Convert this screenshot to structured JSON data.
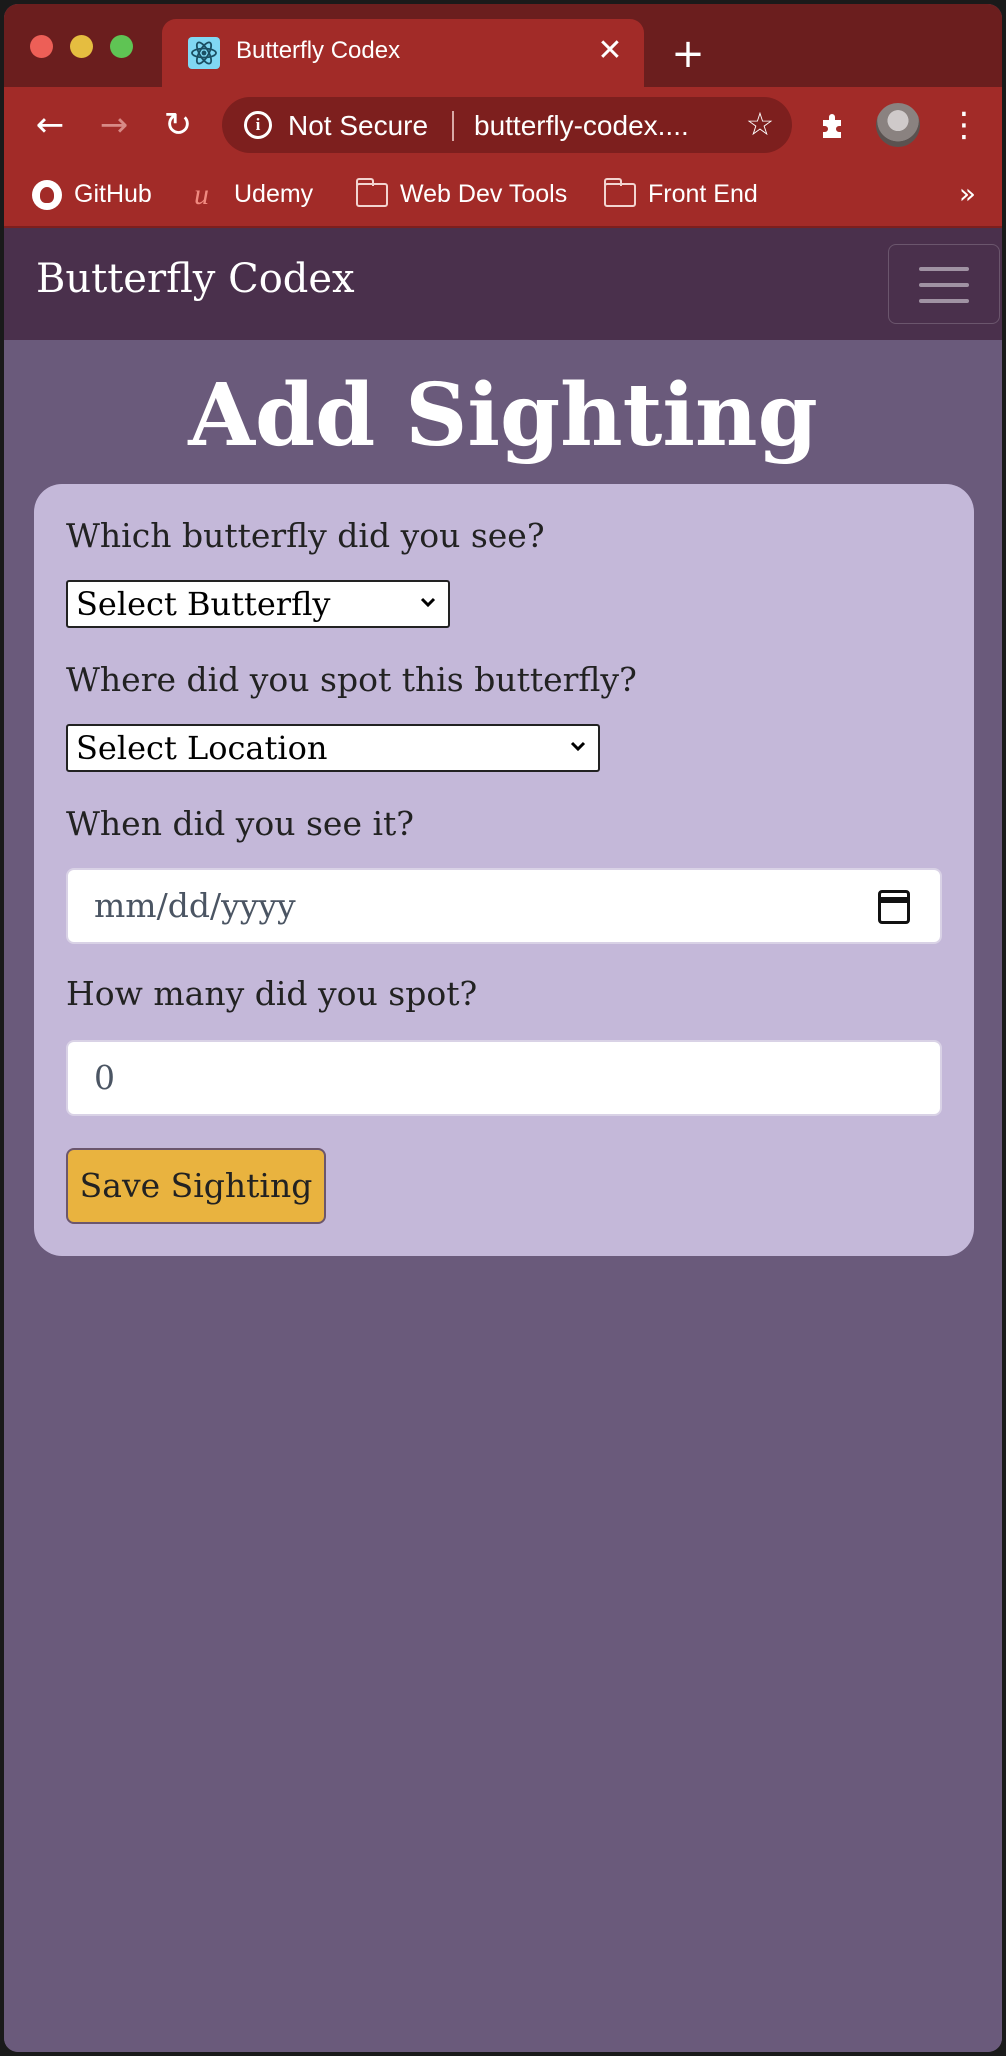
{
  "browser": {
    "tab": {
      "title": "Butterfly Codex",
      "close_glyph": "✕",
      "favicon": "react-logo-icon"
    },
    "new_tab_glyph": "+",
    "toolbar": {
      "back_glyph": "←",
      "forward_glyph": "→",
      "reload_glyph": "↻",
      "security_label": "Not Secure",
      "url": "butterfly-codex....",
      "bookmark_star_glyph": "☆",
      "menu_glyph": "⋮"
    },
    "bookmarks": [
      {
        "label": "GitHub",
        "icon": "github-icon"
      },
      {
        "label": "Udemy",
        "icon": "udemy-icon"
      },
      {
        "label": "Web Dev Tools",
        "icon": "folder-icon"
      },
      {
        "label": "Front End",
        "icon": "folder-icon"
      }
    ],
    "bookmarks_overflow": "»"
  },
  "navbar": {
    "brand": "Butterfly Codex"
  },
  "page": {
    "title": "Add Sighting"
  },
  "form": {
    "butterfly": {
      "label": "Which butterfly did you see?",
      "selected": "Select Butterfly"
    },
    "location": {
      "label": "Where did you spot this butterfly?",
      "selected": "Select Location"
    },
    "date": {
      "label": "When did you see it?",
      "placeholder": "mm/dd/yyyy"
    },
    "count": {
      "label": "How many did you spot?",
      "value": "0"
    },
    "submit_label": "Save Sighting"
  },
  "colors": {
    "tab_strip": "#6b1e1e",
    "toolbar": "#a22b28",
    "navbar": "#4a304c",
    "page_bg": "#6a5a7b",
    "card_bg": "#c4b8d9",
    "button": "#e9b33f"
  }
}
